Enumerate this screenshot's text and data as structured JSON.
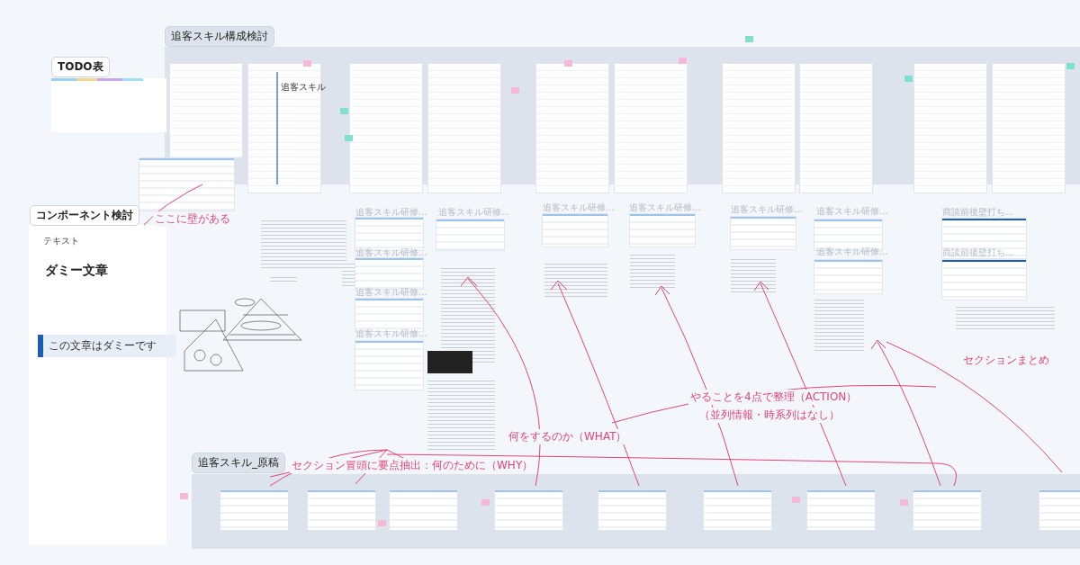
{
  "sections": [
    {
      "label": "追客スキル構成検討"
    },
    {
      "label": "TODO表"
    },
    {
      "label": "コンポーネント検討"
    },
    {
      "label": "追客スキル_原稿"
    }
  ],
  "cover_page": {
    "title": "追客スキル"
  },
  "frame_titles": [
    "追客スキル研修...",
    "追客スキル研修...",
    "追客スキル研修...",
    "追客スキル研修...",
    "追客スキル研修...",
    "追客スキル研修...",
    "追客スキル研修...",
    "追客スキル研修...",
    "追客スキル研修...",
    "追客スキル研修...",
    "商談前後壁打ち...",
    "商談前後壁打ち..."
  ],
  "component_doc": {
    "label": "テキスト",
    "title": "ダミー文章",
    "heading": "この文章はダミーです"
  },
  "annotations": [
    "ここに壁がある",
    "セクションまとめ",
    "やることを4点で整理（ACTION）",
    "（並列情報・時系列はなし）",
    "何をするのか（WHAT）",
    "セクション冒頭に要点抽出：何のために（WHY）"
  ]
}
